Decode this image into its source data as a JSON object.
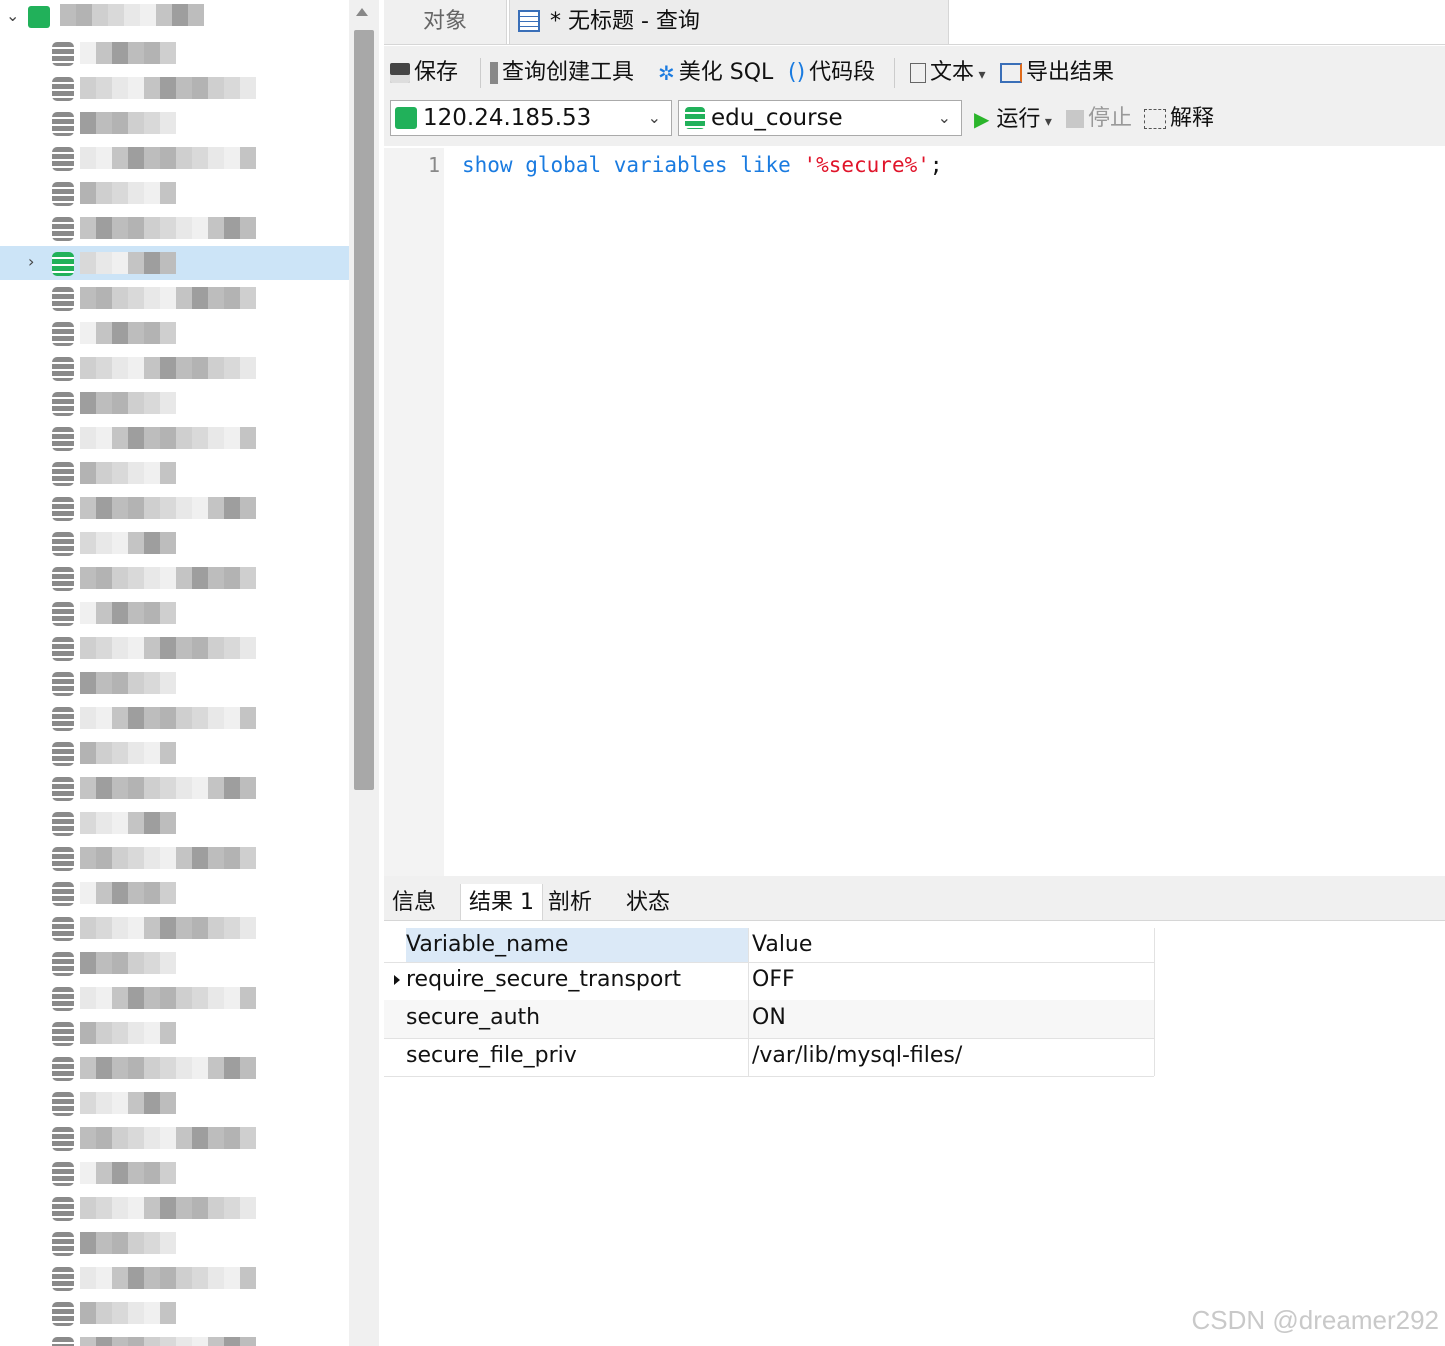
{
  "tabs": {
    "objects": "对象",
    "query": "* 无标题 - 查询"
  },
  "toolbar": {
    "save": "保存",
    "query_builder": "查询创建工具",
    "beautify": "美化 SQL",
    "snippet": "代码段",
    "text": "文本",
    "export": "导出结果",
    "run": "运行",
    "stop": "停止",
    "explain": "解释"
  },
  "connection": {
    "host": "120.24.185.53",
    "database": "edu_course"
  },
  "editor": {
    "line_number": "1",
    "code": [
      {
        "t": "show",
        "k": "kw"
      },
      {
        "t": " ",
        "k": ""
      },
      {
        "t": "global",
        "k": "kw"
      },
      {
        "t": " ",
        "k": ""
      },
      {
        "t": "variables",
        "k": "kw"
      },
      {
        "t": " ",
        "k": ""
      },
      {
        "t": "like",
        "k": "kw"
      },
      {
        "t": " ",
        "k": ""
      },
      {
        "t": "'%secure%'",
        "k": "str"
      },
      {
        "t": ";",
        "k": ""
      }
    ]
  },
  "result_tabs": [
    "信息",
    "结果 1",
    "剖析",
    "状态"
  ],
  "results": {
    "columns": [
      "Variable_name",
      "Value"
    ],
    "rows": [
      [
        "require_secure_transport",
        "OFF"
      ],
      [
        "secure_auth",
        "ON"
      ],
      [
        "secure_file_priv",
        "/var/lib/mysql-files/"
      ]
    ]
  },
  "watermark": "CSDN @dreamer292",
  "colors": {
    "accent": "#1a7be0",
    "string": "#e0142a",
    "selection": "#cce4f7",
    "db_green": "#21b15a"
  }
}
